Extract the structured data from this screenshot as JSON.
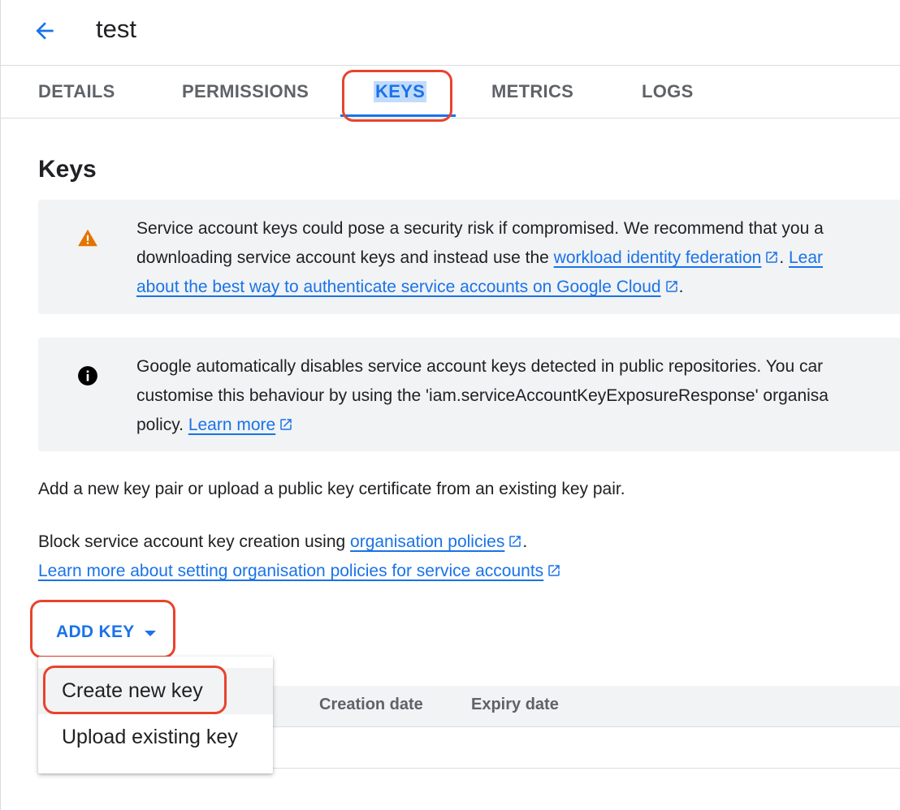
{
  "header": {
    "title": "test",
    "back_icon": "arrow-back-icon"
  },
  "tabs": [
    {
      "label": "DETAILS"
    },
    {
      "label": "PERMISSIONS"
    },
    {
      "label": "KEYS",
      "active": true
    },
    {
      "label": "METRICS"
    },
    {
      "label": "LOGS"
    }
  ],
  "section": {
    "heading": "Keys"
  },
  "warning_banner": {
    "icon": "warning-icon",
    "line1": "Service account keys could pose a security risk if compromised. We recommend that you a",
    "line2_pre": "downloading service account keys and instead use the ",
    "link1": "workload identity federation",
    "line2_mid": ". ",
    "link2_start": "Lear",
    "link2_rest": "about the best way to authenticate service accounts on Google Cloud",
    "line3_end": "."
  },
  "info_banner": {
    "icon": "info-icon",
    "line1": "Google automatically disables service account keys detected in public repositories. You car",
    "line2": "customise this behaviour by using the 'iam.serviceAccountKeyExposureResponse' organisa",
    "line3_pre": "policy. ",
    "link": "Learn more"
  },
  "description": "Add a new key pair or upload a public key certificate from an existing key pair.",
  "policy": {
    "text_pre": "Block service account key creation using ",
    "link1": "organisation policies",
    "text_post": ".",
    "link2": "Learn more about setting organisation policies for service accounts"
  },
  "add_key": {
    "label": "ADD KEY"
  },
  "menu": {
    "items": [
      {
        "label": "Create new key"
      },
      {
        "label": "Upload existing key"
      }
    ]
  },
  "table": {
    "columns": [
      "Creation date",
      "Expiry date"
    ]
  },
  "colors": {
    "accent": "#1a73e8",
    "warning": "#e37400",
    "annotation": "#e8432d"
  }
}
